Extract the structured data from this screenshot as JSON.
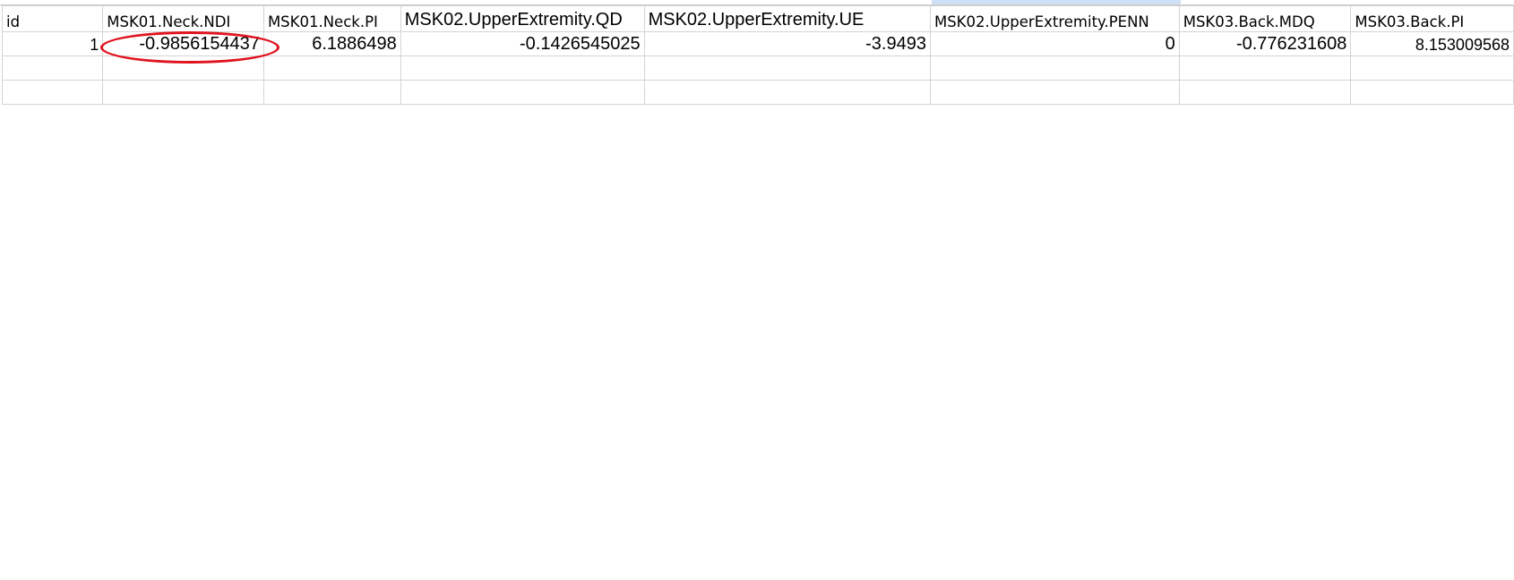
{
  "sheet": {
    "headers": [
      "id",
      "MSK01.Neck.NDI",
      "MSK01.Neck.PI",
      "MSK02.UpperExtremity.QD",
      "MSK02.UpperExtremity.UE",
      "MSK02.UpperExtremity.PENN",
      "MSK03.Back.MDQ",
      "MSK03.Back.PI"
    ],
    "rows": [
      [
        "1",
        "-0.9856154437",
        "6.1886498",
        "-0.1426545025",
        "-3.9493",
        "0",
        "-0.776231608",
        "8.153009568"
      ]
    ]
  },
  "annotation": {
    "shape": "ellipse",
    "color": "#e0141e",
    "target_value": "-0.9856154437"
  }
}
